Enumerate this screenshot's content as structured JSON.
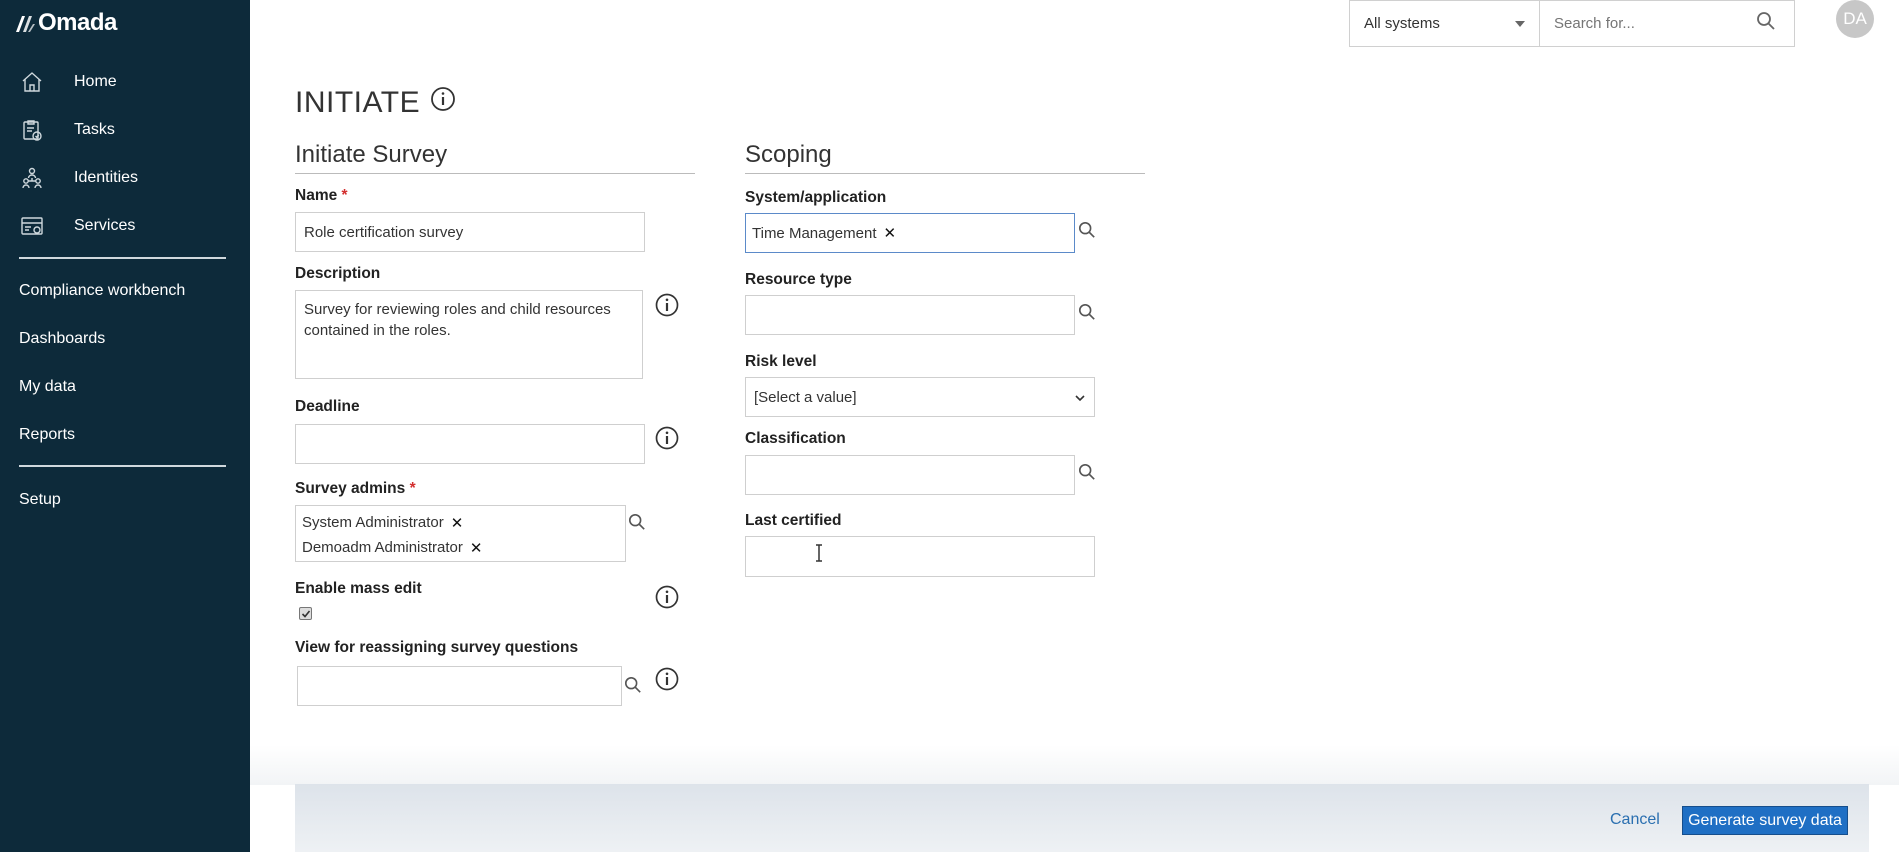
{
  "app": {
    "brand": "Omada"
  },
  "sidebar": {
    "items": [
      {
        "label": "Home",
        "icon": "home-icon"
      },
      {
        "label": "Tasks",
        "icon": "tasks-icon"
      },
      {
        "label": "Identities",
        "icon": "identities-icon"
      },
      {
        "label": "Services",
        "icon": "services-icon"
      }
    ],
    "links": [
      "Compliance workbench",
      "Dashboards",
      "My data",
      "Reports"
    ],
    "setup": "Setup"
  },
  "topbar": {
    "system_select": "All systems",
    "search_placeholder": "Search for...",
    "avatar_initials": "DA"
  },
  "page": {
    "title": "INITIATE"
  },
  "survey": {
    "heading": "Initiate Survey",
    "name_label": "Name",
    "name_value": "Role certification survey",
    "description_label": "Description",
    "description_value": "Survey for reviewing roles and child resources contained in the roles.",
    "deadline_label": "Deadline",
    "deadline_value": "",
    "admins_label": "Survey admins",
    "admins": [
      "System Administrator",
      "Demoadm Administrator"
    ],
    "mass_edit_label": "Enable mass edit",
    "mass_edit_checked": true,
    "reassign_view_label": "View for reassigning survey questions",
    "reassign_view_value": "",
    "required_mark": "*"
  },
  "scoping": {
    "heading": "Scoping",
    "system_label": "System/application",
    "system_chip": "Time Management",
    "resource_type_label": "Resource type",
    "risk_level_label": "Risk level",
    "risk_level_value": "[Select a value]",
    "classification_label": "Classification",
    "last_certified_label": "Last certified"
  },
  "footer": {
    "cancel_label": "Cancel",
    "generate_label": "Generate survey data"
  },
  "remove_glyph": "✕",
  "colors": {
    "sidebar_bg": "#0d2a3a",
    "primary": "#1f6fc4",
    "link": "#2a6fb0",
    "required": "#d32f2f"
  }
}
